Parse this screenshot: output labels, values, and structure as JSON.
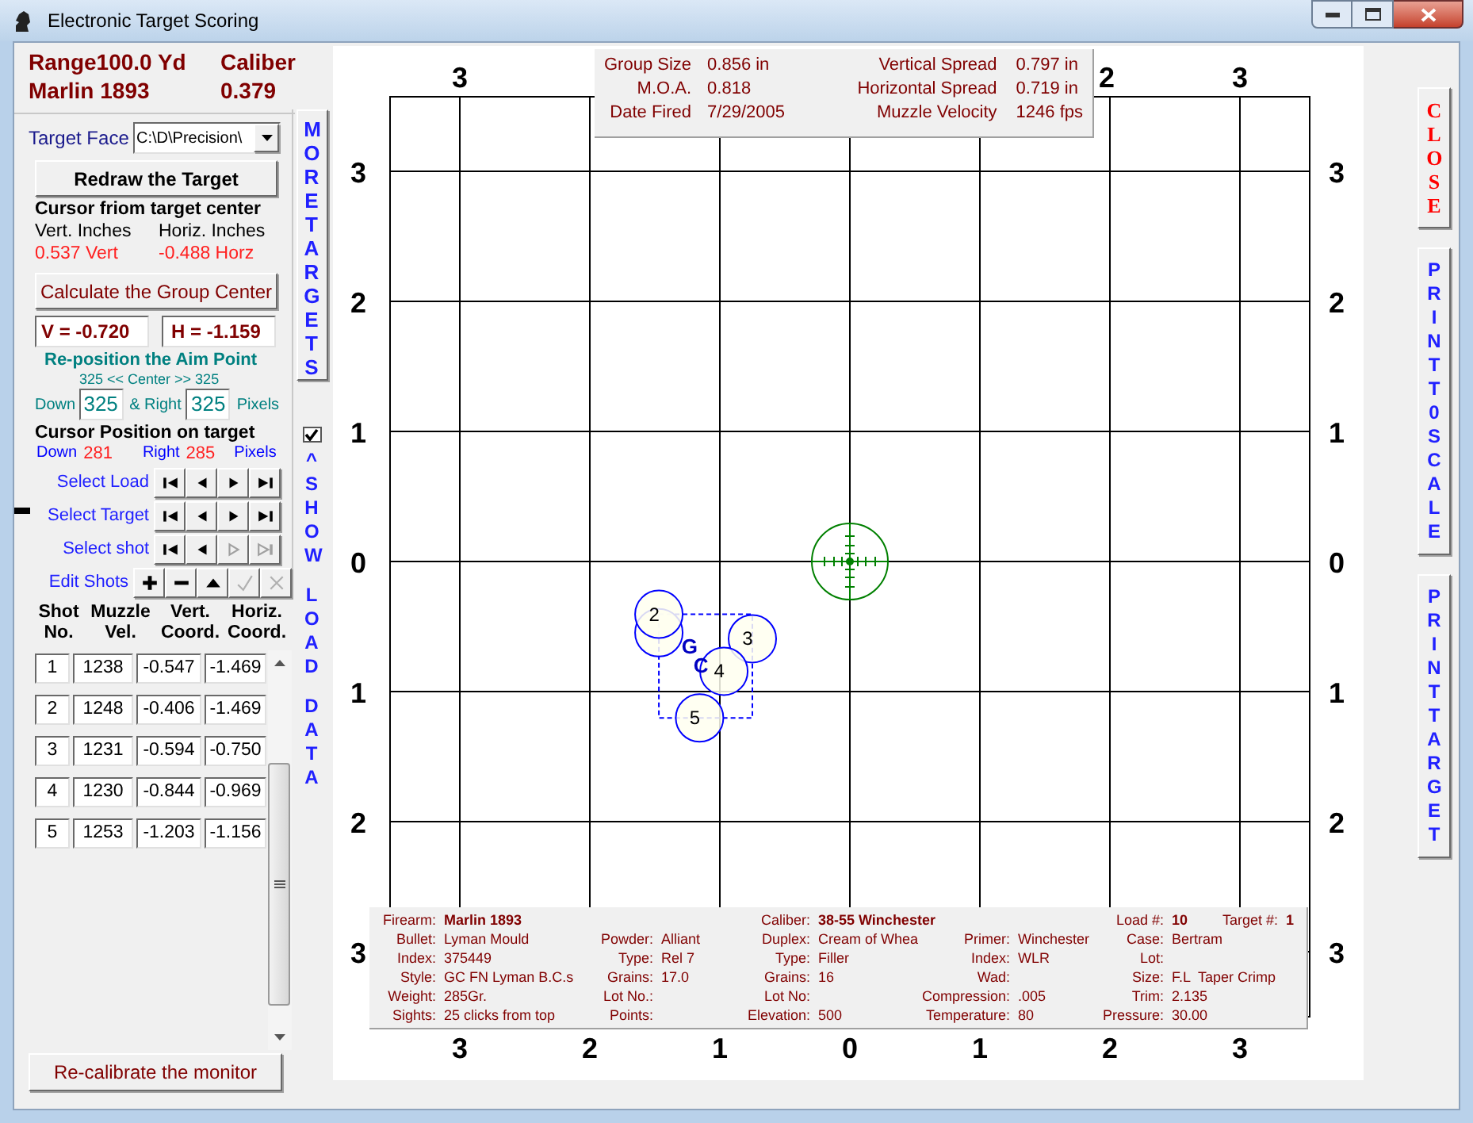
{
  "window": {
    "title": "Electronic Target Scoring"
  },
  "summary": {
    "range_label": "Range",
    "range_value": "100.0 Yd",
    "caliber_label": "Caliber",
    "firearm": "Marlin 1893",
    "caliber_value": "0.379"
  },
  "target_face": {
    "label": "Target Face",
    "value": "C:\\D\\Precision\\"
  },
  "redraw_button": "Redraw the Target",
  "cursor_offset": {
    "title": "Cursor friom target center",
    "vert_label": "Vert. Inches",
    "horiz_label": "Horiz. Inches",
    "vert_value": "0.537 Vert",
    "horiz_value": "-0.488 Horz"
  },
  "group_center_button": "Calculate the Group Center",
  "group_center": {
    "v": "V = -0.720",
    "h": "H = -1.159"
  },
  "aim_point": {
    "title": "Re-position the Aim Point",
    "center_line": "325 << Center >> 325",
    "down_label": "Down",
    "down_value": "325",
    "right_label": "& Right",
    "right_value": "325",
    "unit": "Pixels"
  },
  "cursor_position": {
    "title": "Cursor Position on target",
    "down_label": "Down",
    "down_value": "281",
    "right_label": "Right",
    "right_value": "285",
    "unit": "Pixels"
  },
  "navigators": [
    {
      "label": "Select Load",
      "buttons": [
        {
          "kind": "first",
          "disabled": false
        },
        {
          "kind": "prev",
          "disabled": false
        },
        {
          "kind": "next",
          "disabled": false
        },
        {
          "kind": "last",
          "disabled": false
        }
      ]
    },
    {
      "label": "Select Target",
      "buttons": [
        {
          "kind": "first",
          "disabled": false
        },
        {
          "kind": "prev",
          "disabled": false
        },
        {
          "kind": "next",
          "disabled": false
        },
        {
          "kind": "last",
          "disabled": false
        }
      ]
    },
    {
      "label": "Select shot",
      "buttons": [
        {
          "kind": "first",
          "disabled": false
        },
        {
          "kind": "prev",
          "disabled": false
        },
        {
          "kind": "next",
          "disabled": true
        },
        {
          "kind": "last",
          "disabled": true
        }
      ]
    },
    {
      "label": "Edit Shots",
      "buttons": [
        {
          "kind": "add",
          "disabled": false
        },
        {
          "kind": "remove",
          "disabled": false
        },
        {
          "kind": "up",
          "disabled": false
        },
        {
          "kind": "accept",
          "disabled": true
        },
        {
          "kind": "cancel",
          "disabled": true
        }
      ]
    }
  ],
  "shot_table": {
    "columns": [
      "Shot\nNo.",
      "Muzzle\nVel.",
      "Vert.\nCoord.",
      "Horiz.\nCoord."
    ],
    "rows": [
      [
        "1",
        "1238",
        "-0.547",
        "-1.469"
      ],
      [
        "2",
        "1248",
        "-0.406",
        "-1.469"
      ],
      [
        "3",
        "1231",
        "-0.594",
        "-0.750"
      ],
      [
        "4",
        "1230",
        "-0.844",
        "-0.969"
      ],
      [
        "5",
        "1253",
        "-1.203",
        "-1.156"
      ]
    ]
  },
  "recalibrate_button": "Re-calibrate the monitor",
  "more_targets_button": "MORE TARGETS",
  "show_load_data": {
    "checked": true,
    "labels": [
      "^ SHOW",
      "LOAD",
      "DATA"
    ]
  },
  "target": {
    "top_labels": [
      "3",
      "2",
      "3"
    ],
    "left_labels": [
      "3",
      "2",
      "1",
      "0",
      "1",
      "2",
      "3"
    ],
    "right_labels": [
      "3",
      "2",
      "1",
      "0",
      "1",
      "2",
      "3"
    ],
    "bottom_labels": [
      "3",
      "2",
      "1",
      "0",
      "1",
      "2",
      "3"
    ],
    "shot_labels": [
      "2",
      "3",
      "4",
      "5"
    ],
    "group_mark": "G",
    "center_mark": "C"
  },
  "group_stats": {
    "left": [
      {
        "label": "Group Size",
        "value": "0.856 in"
      },
      {
        "label": "M.O.A.",
        "value": "0.818"
      },
      {
        "label": "Date Fired",
        "value": "7/29/2005"
      }
    ],
    "right": [
      {
        "label": "Vertical Spread",
        "value": "0.797 in"
      },
      {
        "label": "Horizontal Spread",
        "value": "0.719 in"
      },
      {
        "label": "Muzzle Velocity",
        "value": "1246 fps"
      }
    ]
  },
  "load_data": {
    "columns": [
      [
        {
          "label": "Firearm:",
          "value": "Marlin 1893"
        },
        {
          "label": "Bullet:",
          "value": "Lyman Mould"
        },
        {
          "label": "Index:",
          "value": "375449"
        },
        {
          "label": "Style:",
          "value": "GC FN Lyman B.C.s"
        },
        {
          "label": "Weight:",
          "value": "285Gr."
        },
        {
          "label": "Sights:",
          "value": "25 clicks from top"
        }
      ],
      [
        {
          "label": "Powder:",
          "value": "Alliant"
        },
        {
          "label": "Type:",
          "value": "Rel 7"
        },
        {
          "label": "Grains:",
          "value": "17.0"
        },
        {
          "label": "Lot No.:"
        },
        {
          "label": "Points:"
        }
      ],
      [
        {
          "label": "Caliber:",
          "value": "38-55 Winchester"
        },
        {
          "label": "Duplex:",
          "value": "Cream of Whea"
        },
        {
          "label": "Type:",
          "value": "Filler"
        },
        {
          "label": "Grains:",
          "value": "16"
        },
        {
          "label": "Lot No:"
        },
        {
          "label": "Elevation:",
          "value": "500"
        }
      ],
      [
        {
          "label": "Primer:",
          "value": "Winchester"
        },
        {
          "label": "Index:",
          "value": "WLR"
        },
        {
          "label": "Wad:"
        },
        {
          "label": "Compression:",
          "value": ".005"
        },
        {
          "label": "Temperature:",
          "value": "80"
        }
      ],
      [
        {
          "label": "Load #:",
          "value": "10"
        },
        {
          "label": "Case:",
          "value": "Bertram"
        },
        {
          "label": "Lot:"
        },
        {
          "label": "Size:",
          "value": "F.L  Taper Crimp"
        },
        {
          "label": "Trim:",
          "value": "2.135"
        },
        {
          "label": "Pressure:",
          "value": "30.00"
        }
      ]
    ],
    "target": {
      "label": "Target #:",
      "value": "1"
    }
  },
  "side_buttons": [
    {
      "kind": "close",
      "label": "CLOSE"
    },
    {
      "kind": "print",
      "label": "PRINT T0 SCALE"
    },
    {
      "kind": "print",
      "label": "PRINT TARGET"
    }
  ]
}
